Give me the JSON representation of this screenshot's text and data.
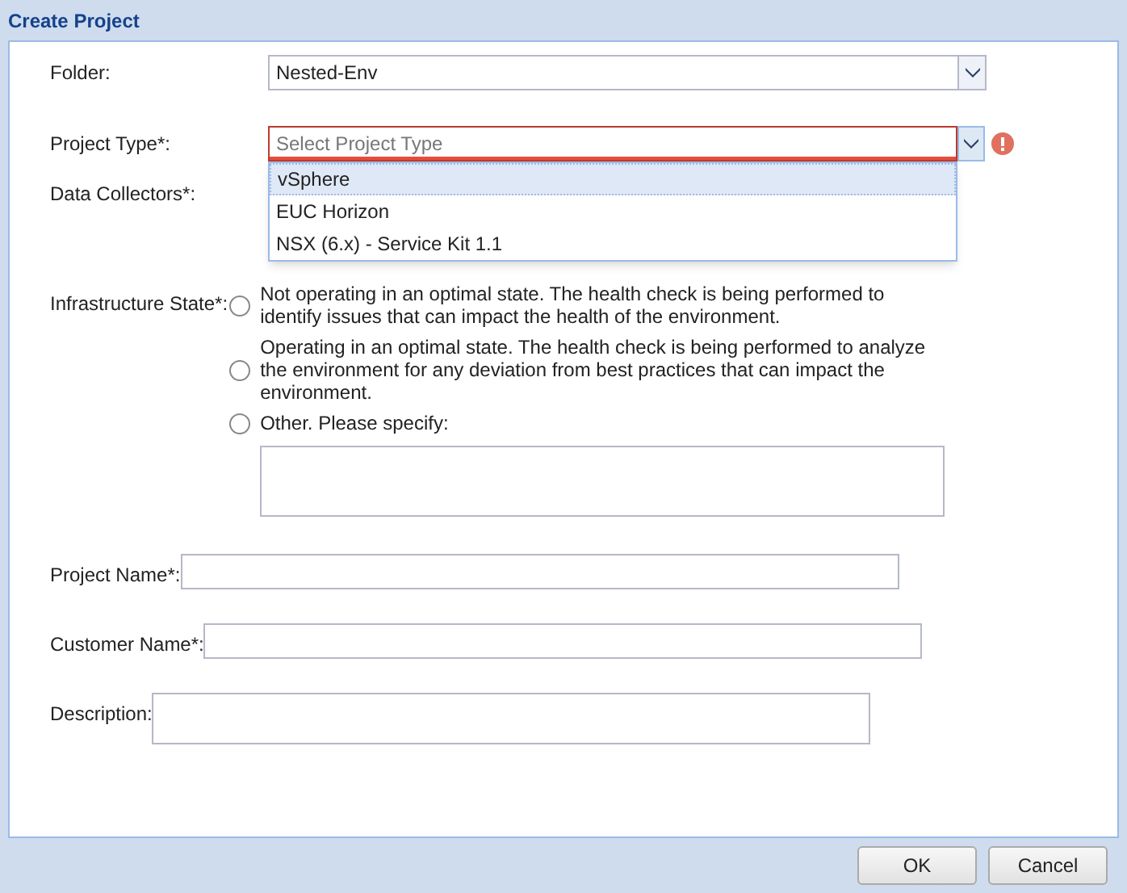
{
  "window": {
    "title": "Create Project"
  },
  "folder": {
    "label": "Folder:",
    "value": "Nested-Env"
  },
  "project_type": {
    "label": "Project Type*:",
    "placeholder": "Select Project Type",
    "invalid": true,
    "expanded": true,
    "options": [
      {
        "label": "vSphere",
        "selected": true
      },
      {
        "label": "EUC Horizon",
        "selected": false
      },
      {
        "label": "NSX (6.x) - Service Kit 1.1",
        "selected": false
      }
    ]
  },
  "data_collectors": {
    "label": "Data Collectors*:"
  },
  "infrastructure_state": {
    "label": "Infrastructure State*:",
    "options": [
      {
        "label": "Not operating in an optimal state. The health check is being performed to identify issues that can impact the health of the environment.",
        "selected": false
      },
      {
        "label": "Operating in an optimal state. The health check is being performed to analyze the environment for any deviation from best practices that can impact the environment.",
        "selected": false
      },
      {
        "label": "Other. Please specify:",
        "selected": false
      }
    ]
  },
  "fields": [
    {
      "label": "Project Name*:",
      "kind": "input"
    },
    {
      "label": "Customer Name*:",
      "kind": "input"
    },
    {
      "label": "Description:",
      "kind": "textarea"
    }
  ],
  "buttons": [
    "OK",
    "Cancel"
  ]
}
